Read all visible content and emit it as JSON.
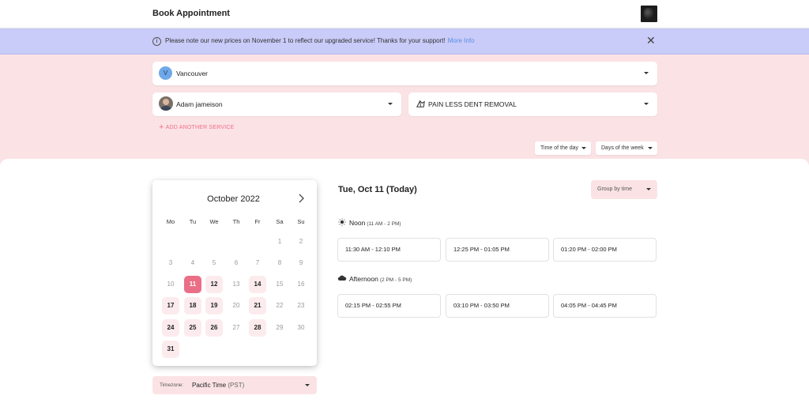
{
  "header": {
    "title": "Book Appointment"
  },
  "notice": {
    "message": "Please note our new prices on November 1 to reflect our upgraded service! Thanks for your support!",
    "link": "More Info"
  },
  "filters": {
    "location": {
      "initial": "V",
      "value": "Vancouver"
    },
    "staff": {
      "value": "Adam jameison"
    },
    "service": {
      "value": "PAIN LESS DENT REMOVAL"
    },
    "add_service": "ADD ANOTHER SERVICE",
    "time_of_day": "Time of the day",
    "days_of_week": "Days of the week"
  },
  "calendar": {
    "month_label": "October 2022",
    "weekdays": [
      "Mo",
      "Tu",
      "We",
      "Th",
      "Fr",
      "Sa",
      "Su"
    ],
    "weeks": [
      [
        null,
        null,
        null,
        null,
        null,
        "1",
        "2"
      ],
      [
        "3",
        "4",
        "5",
        "6",
        "7",
        "8",
        "9"
      ],
      [
        "10",
        "11",
        "12",
        "13",
        "14",
        "15",
        "16"
      ],
      [
        "17",
        "18",
        "19",
        "20",
        "21",
        "22",
        "23"
      ],
      [
        "24",
        "25",
        "26",
        "27",
        "28",
        "29",
        "30"
      ],
      [
        "31",
        null,
        null,
        null,
        null,
        null,
        null
      ]
    ],
    "selected": "11",
    "available": [
      "12",
      "14",
      "17",
      "18",
      "19",
      "21",
      "24",
      "25",
      "26",
      "28",
      "31"
    ]
  },
  "timezone": {
    "label": "Timezone:",
    "value": "Pacific Time",
    "abbr": "(PST)"
  },
  "schedule": {
    "day_title": "Tue, Oct 11 (Today)",
    "group_by": "Group by time",
    "periods": [
      {
        "name": "Noon",
        "range": "(11 AM - 2 PM)",
        "icon": "sun-icon",
        "slots": [
          "11:30 AM - 12:10 PM",
          "12:25 PM - 01:05 PM",
          "01:20 PM - 02:00 PM"
        ]
      },
      {
        "name": "Afternoon",
        "range": "(2 PM - 5 PM)",
        "icon": "cloud-icon",
        "slots": [
          "02:15 PM - 02:55 PM",
          "03:10 PM - 03:50 PM",
          "04:05 PM - 04:45 PM"
        ]
      }
    ]
  },
  "colors": {
    "notice_bg": "#c9cbf8",
    "filters_bg": "#fbe3e5",
    "accent": "#eb6e87",
    "link": "#5b8ee6"
  }
}
